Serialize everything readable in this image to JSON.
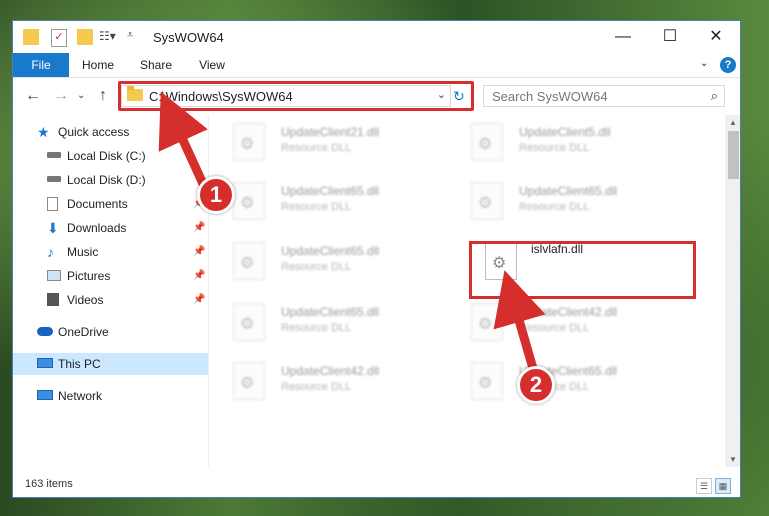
{
  "window": {
    "title": "SysWOW64",
    "minimize": "—",
    "maximize": "☐",
    "close": "✕"
  },
  "ribbon": {
    "tabs": [
      "File",
      "Home",
      "Share",
      "View"
    ],
    "help": "?",
    "expand": "⌄"
  },
  "nav": {
    "back": "←",
    "forward": "→",
    "recent": "⌄",
    "up": "↑",
    "address": "C:\\Windows\\SysWOW64",
    "address_dropdown": "⌄",
    "refresh": "↻",
    "search_placeholder": "Search SysWOW64",
    "search_icon": "⌕"
  },
  "sidebar": {
    "items": [
      {
        "label": "Quick access",
        "icon": "star-icon"
      },
      {
        "label": "Local Disk (C:)",
        "icon": "drive-icon"
      },
      {
        "label": "Local Disk (D:)",
        "icon": "drive-icon"
      },
      {
        "label": "Documents",
        "icon": "documents-icon"
      },
      {
        "label": "Downloads",
        "icon": "download-icon"
      },
      {
        "label": "Music",
        "icon": "music-icon"
      },
      {
        "label": "Pictures",
        "icon": "pictures-icon"
      },
      {
        "label": "Videos",
        "icon": "videos-icon"
      },
      {
        "label": "OneDrive",
        "icon": "cloud-icon"
      },
      {
        "label": "This PC",
        "icon": "computer-icon"
      },
      {
        "label": "Network",
        "icon": "network-icon"
      }
    ],
    "pin": "📌"
  },
  "files": [
    {
      "name": "UpdateClient21.dll",
      "type": "Resource DLL"
    },
    {
      "name": "UpdateClient5.dll",
      "type": "Resource DLL"
    },
    {
      "name": "UpdateClient65.dll",
      "type": "Resource DLL"
    },
    {
      "name": "UpdateClient65.dll",
      "type": "Resource DLL"
    },
    {
      "name": "UpdateClient65.dll",
      "type": "Resource DLL"
    },
    {
      "name": "islvlafn.dll",
      "type": ""
    },
    {
      "name": "UpdateClient65.dll",
      "type": "Resource DLL"
    },
    {
      "name": "UpdateClient42.dll",
      "type": "Resource DLL"
    },
    {
      "name": "UpdateClient42.dll",
      "type": "Resource DLL"
    },
    {
      "name": "UpdateClient65.dll",
      "type": "Resource DLL"
    }
  ],
  "status": {
    "item_count": "163 items"
  },
  "annotations": {
    "step1": "1",
    "step2": "2",
    "color": "#d62d2d"
  }
}
